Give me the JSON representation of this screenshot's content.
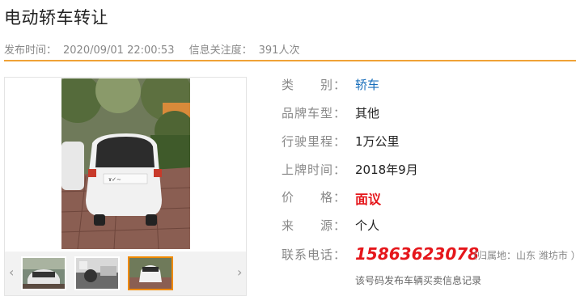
{
  "title": "电动轿车转让",
  "meta": {
    "publish_label": "发布时间：",
    "publish_time": "2020/09/01 22:00:53",
    "attention_label": "信息关注度：",
    "attention_value": "391人次"
  },
  "gallery": {
    "prev_arrow": "‹",
    "next_arrow": "›",
    "thumb_count": 3,
    "active_thumb": 3
  },
  "details": {
    "category_label": "类　　别：",
    "category_value": "轿车",
    "brand_label": "品牌车型：",
    "brand_value": "其他",
    "mileage_label": "行驶里程：",
    "mileage_value": "1万公里",
    "registration_label": "上牌时间：",
    "registration_value": "2018年9月",
    "price_label": "价　　格：",
    "price_value": "面议",
    "source_label": "来　　源：",
    "source_value": "个人",
    "phone_label": "联系电话：",
    "phone_value": "15863623078",
    "phone_location": "（归属地：山东 潍坊市 ）",
    "record_link": "该号码发布车辆买卖信息记录"
  },
  "colors": {
    "accent": "#f0a236",
    "link": "#1a6fbb",
    "price": "#e5161b",
    "thumb_active": "#f08a00"
  }
}
